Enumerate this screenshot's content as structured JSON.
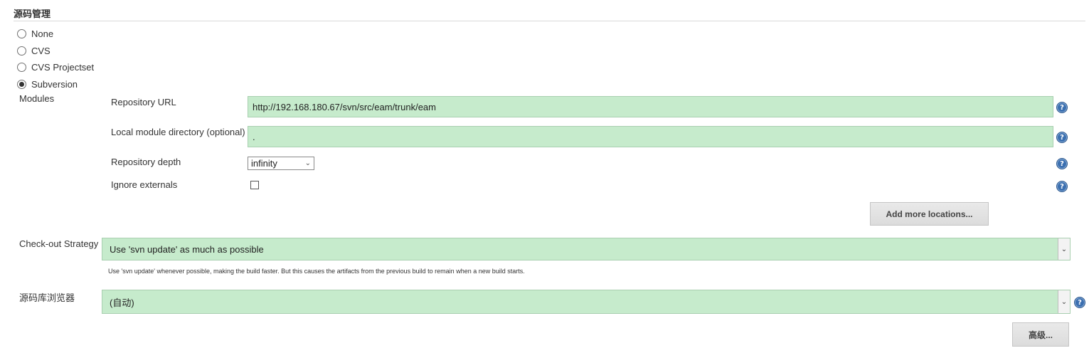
{
  "section": {
    "title": "源码管理"
  },
  "scm_options": [
    {
      "label": "None",
      "checked": false
    },
    {
      "label": "CVS",
      "checked": false
    },
    {
      "label": "CVS Projectset",
      "checked": false
    },
    {
      "label": "Subversion",
      "checked": true
    }
  ],
  "modules": {
    "label": "Modules",
    "repository_url": {
      "label": "Repository URL",
      "value": "http://192.168.180.67/svn/src/eam/trunk/eam"
    },
    "local_dir": {
      "label": "Local module directory (optional)",
      "value": "."
    },
    "depth": {
      "label": "Repository depth",
      "value": "infinity"
    },
    "ignore_externals": {
      "label": "Ignore externals",
      "checked": false
    },
    "add_more_label": "Add more locations..."
  },
  "checkout": {
    "label": "Check-out Strategy",
    "value": "Use 'svn update' as much as possible",
    "description": "Use 'svn update' whenever possible, making the build faster. But this causes the artifacts from the previous build to remain when a new build starts."
  },
  "browser": {
    "label": "源码库浏览器",
    "value": "(自动)"
  },
  "advanced_label": "高级...",
  "icons": {
    "help": "help-icon",
    "dropdown": "chevron-down-icon"
  },
  "colors": {
    "field_green": "#c6ebcc",
    "help_blue": "#3b6fb0"
  }
}
